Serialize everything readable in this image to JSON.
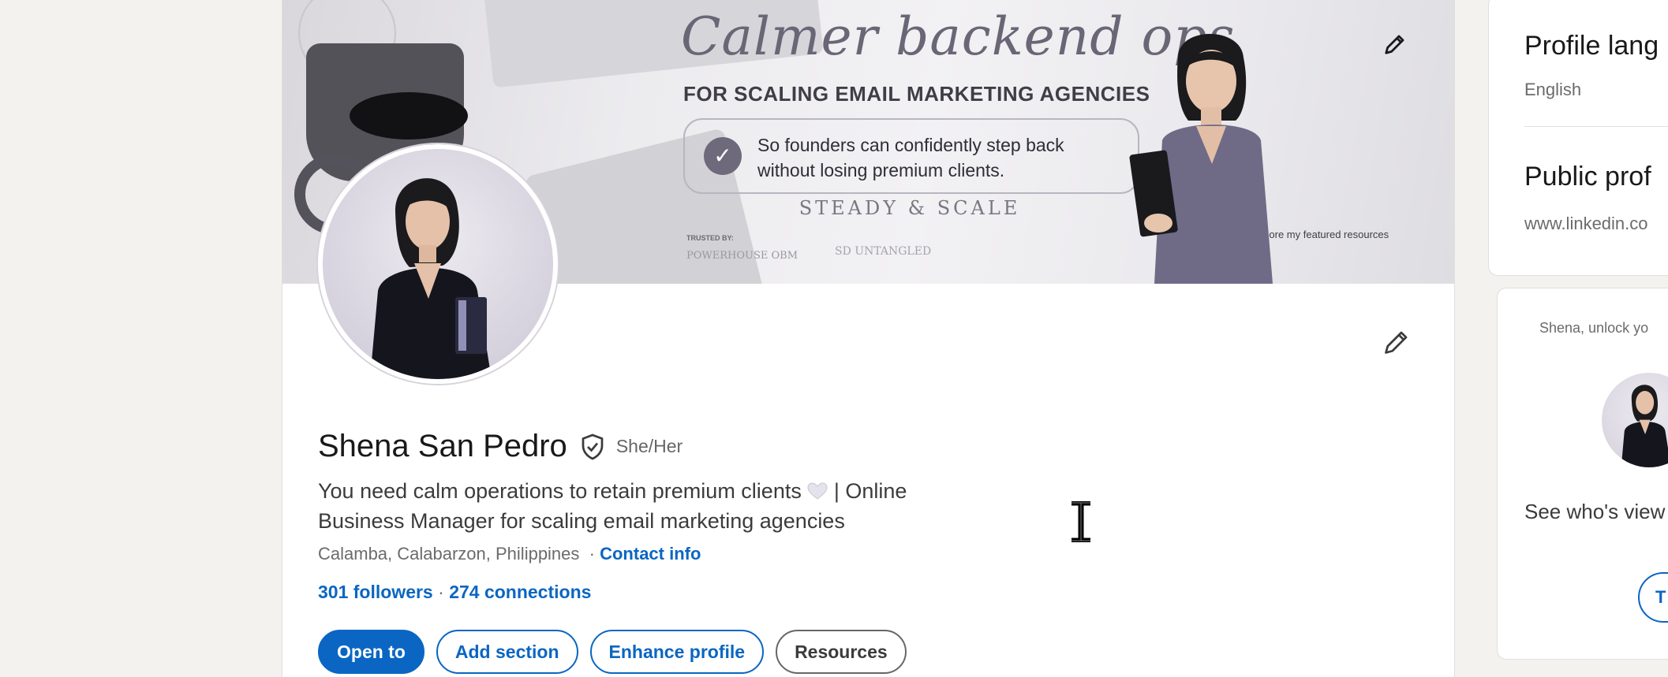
{
  "banner": {
    "title": "Calmer backend ops",
    "subtitle": "FOR SCALING EMAIL MARKETING AGENCIES",
    "tagline_line1": "So founders can confidently step back",
    "tagline_line2": "without losing premium clients.",
    "brand": "STEADY & SCALE",
    "trusted_by": "TRUSTED BY:",
    "partner1": "POWERHOUSE OBM",
    "partner2": "SD UNTANGLED",
    "explore": "↓ Explore my featured resources"
  },
  "profile": {
    "name": "Shena San Pedro",
    "pronouns": "She/Her",
    "headline_line1_pre": "You need calm operations to retain premium clients",
    "headline_line1_post": " | Online",
    "headline_line2": "Business Manager for scaling email marketing agencies",
    "location": "Calamba, Calabarzon, Philippines",
    "contact_info": "Contact info",
    "followers": "301 followers",
    "connections": "274 connections"
  },
  "actions": {
    "open_to": "Open to",
    "add_section": "Add section",
    "enhance_profile": "Enhance profile",
    "resources": "Resources"
  },
  "sidebar": {
    "profile_language_title": "Profile lang",
    "profile_language_value": "English",
    "public_profile_title": "Public prof",
    "public_profile_url": "www.linkedin.co",
    "promo_text": "Shena, unlock yo",
    "views_text": "See who's view",
    "button_label": "T"
  },
  "colors": {
    "accent": "#0a66c2",
    "background": "#f3f2ef"
  }
}
